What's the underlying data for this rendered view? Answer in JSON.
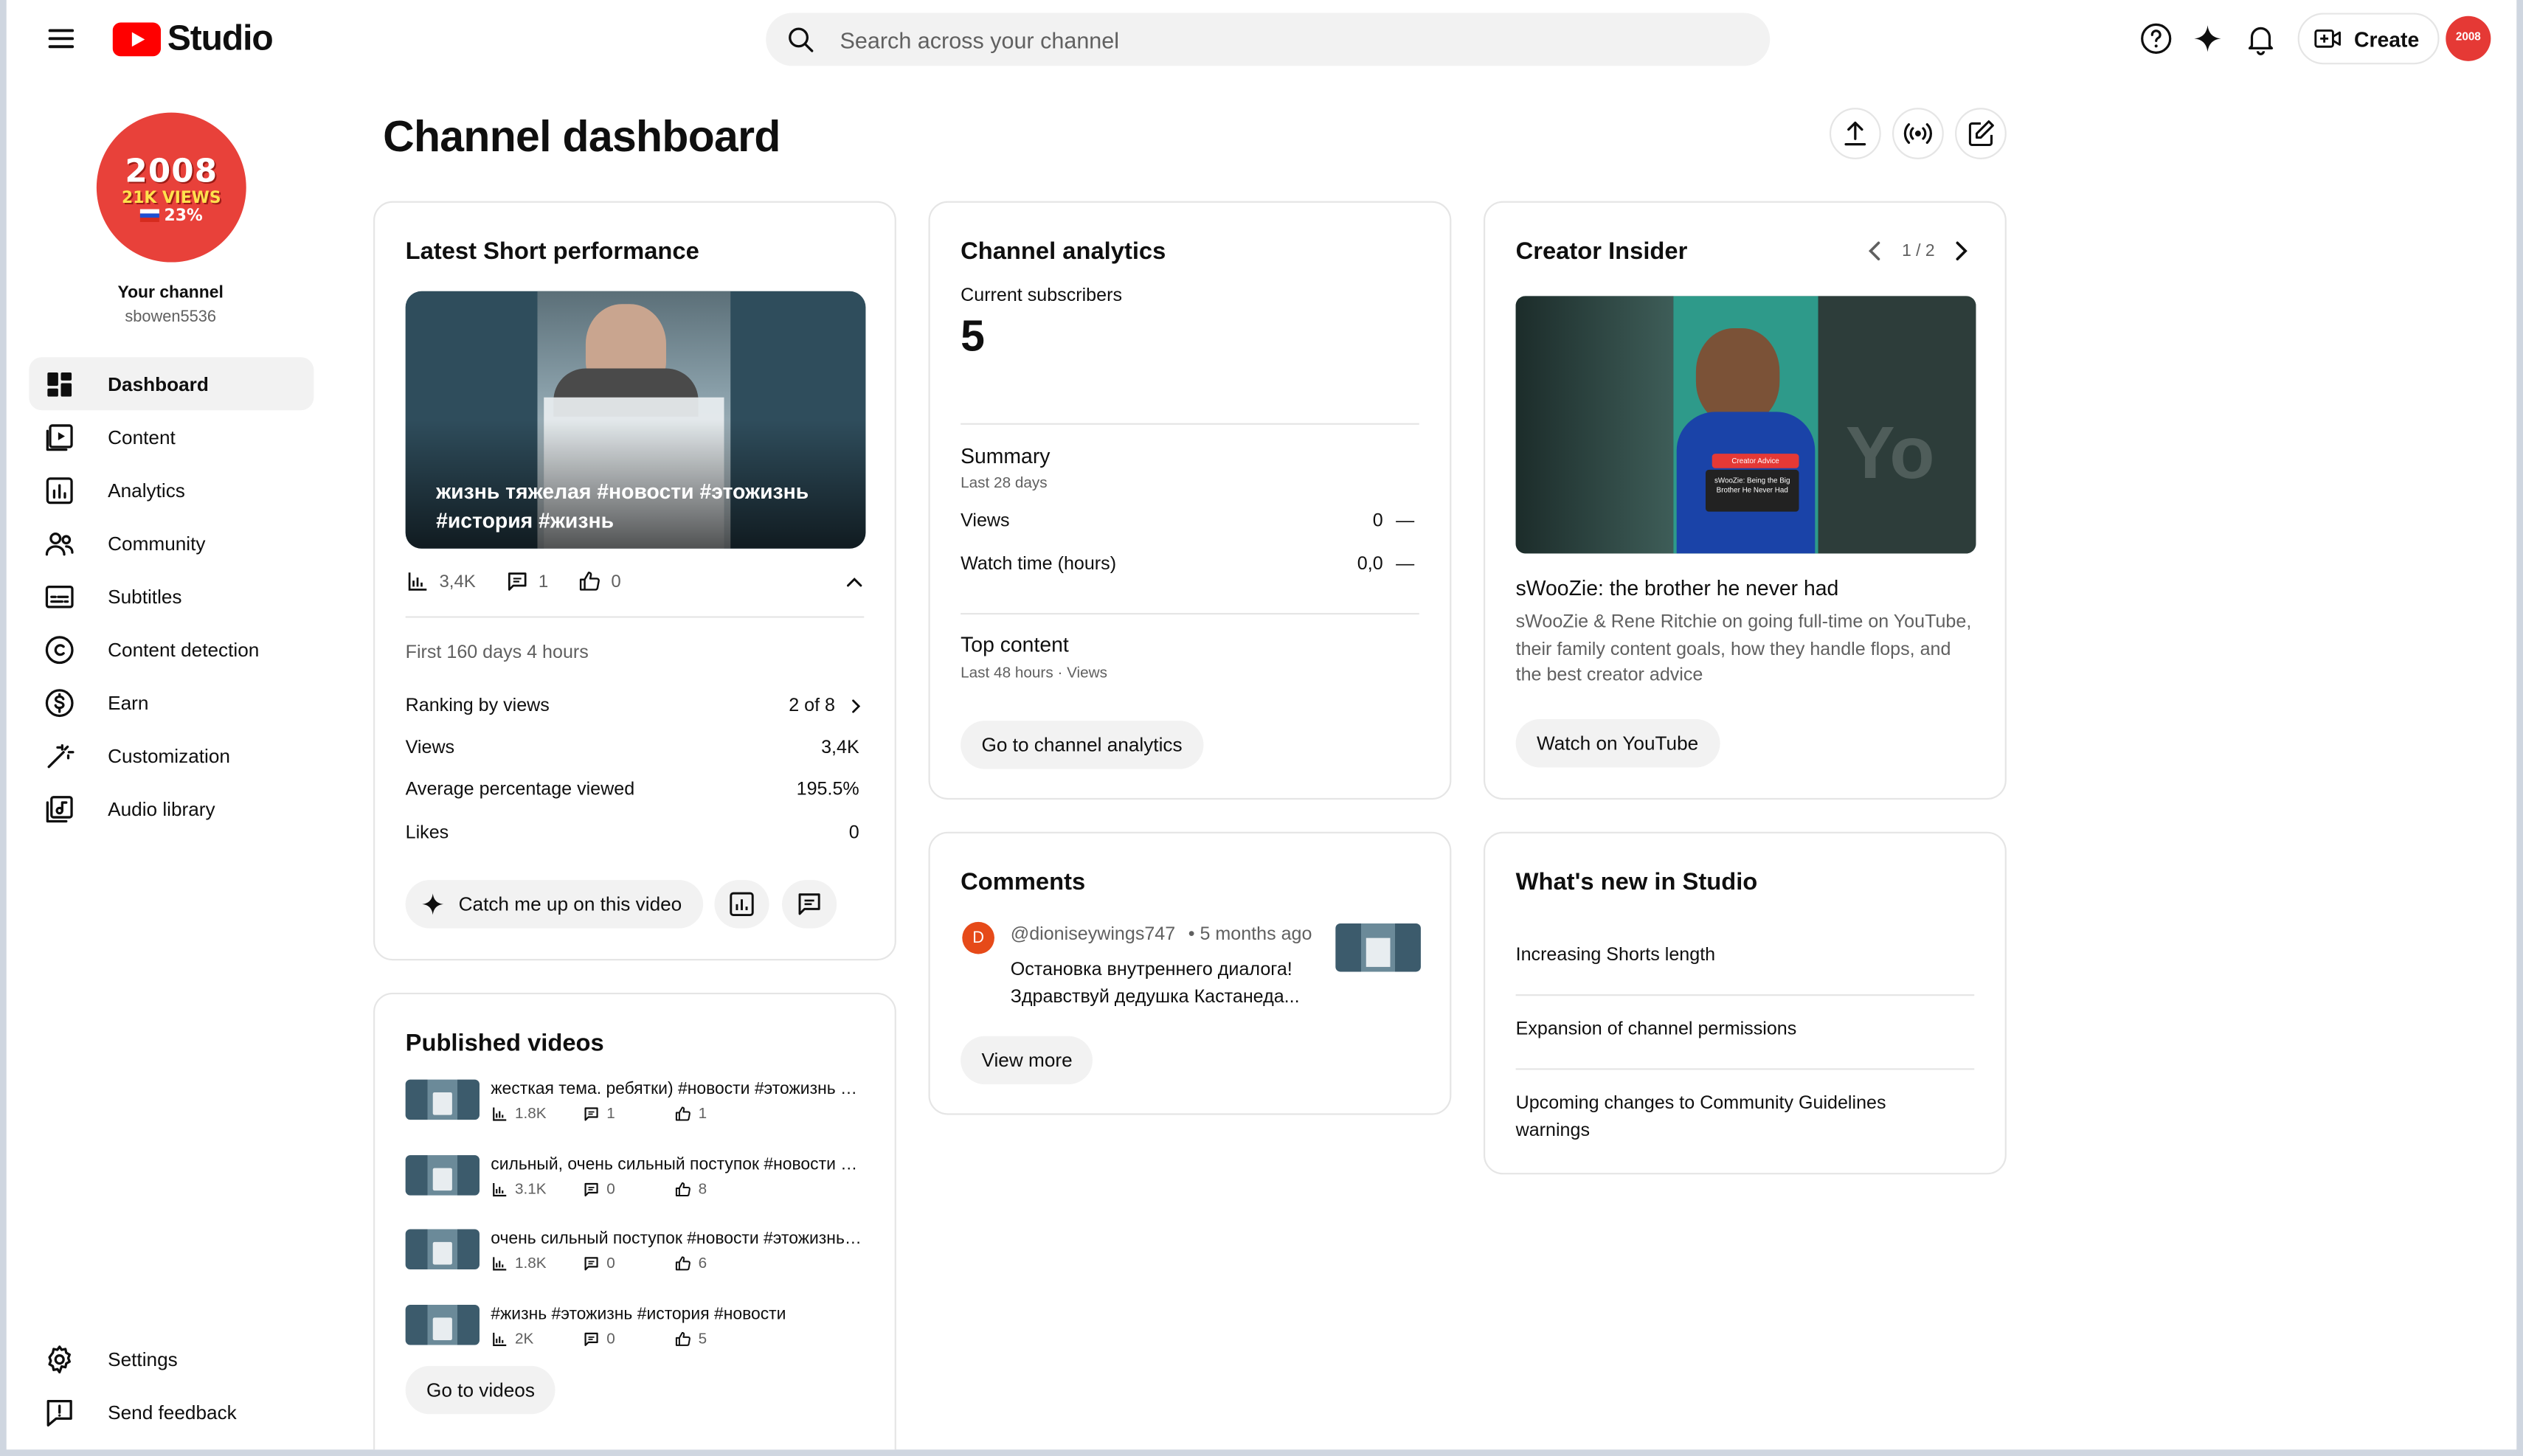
{
  "app": {
    "logo_text": "Studio",
    "search_placeholder": "Search across your channel",
    "create_label": "Create"
  },
  "channel": {
    "avatar_year": "2008",
    "avatar_views": "21K VIEWS",
    "avatar_pct": "23%",
    "your_channel_label": "Your channel",
    "handle": "sbowen5536"
  },
  "sidebar": {
    "items": [
      {
        "label": "Dashboard",
        "icon": "dashboard-icon"
      },
      {
        "label": "Content",
        "icon": "content-icon"
      },
      {
        "label": "Analytics",
        "icon": "analytics-icon"
      },
      {
        "label": "Community",
        "icon": "community-icon"
      },
      {
        "label": "Subtitles",
        "icon": "subtitles-icon"
      },
      {
        "label": "Content detection",
        "icon": "copyright-icon"
      },
      {
        "label": "Earn",
        "icon": "dollar-icon"
      },
      {
        "label": "Customization",
        "icon": "magic-wand-icon"
      },
      {
        "label": "Audio library",
        "icon": "audio-library-icon"
      }
    ],
    "bottom": [
      {
        "label": "Settings",
        "icon": "gear-icon"
      },
      {
        "label": "Send feedback",
        "icon": "feedback-icon"
      }
    ]
  },
  "page": {
    "title": "Channel dashboard"
  },
  "latest_short": {
    "title": "Latest Short performance",
    "thumb_caption": "жизнь тяжелая #новости #этожизнь #история #жизнь",
    "views": "3,4K",
    "comments": "1",
    "likes": "0",
    "period": "First 160 days 4 hours",
    "rows": [
      {
        "label": "Ranking by views",
        "value": "2 of 8"
      },
      {
        "label": "Views",
        "value": "3,4K"
      },
      {
        "label": "Average percentage viewed",
        "value": "195.5%"
      },
      {
        "label": "Likes",
        "value": "0"
      }
    ],
    "catch_up_label": "Catch me up on this video"
  },
  "analytics": {
    "title": "Channel analytics",
    "subs_label": "Current subscribers",
    "subs_value": "5",
    "summary_title": "Summary",
    "summary_period": "Last 28 days",
    "rows": [
      {
        "label": "Views",
        "value": "0",
        "trend": "—"
      },
      {
        "label": "Watch time (hours)",
        "value": "0,0",
        "trend": "—"
      }
    ],
    "top_content_title": "Top content",
    "top_content_period": "Last 48 hours · Views",
    "button_label": "Go to channel analytics"
  },
  "insider": {
    "title": "Creator Insider",
    "pager": "1 / 2",
    "video_title": "sWooZie: the brother he never had",
    "description": "sWooZie & Rene Ritchie on going full-time on YouTube, their family content goals, how they handle flops, and the best creator advice",
    "button_label": "Watch on YouTube",
    "thumb_badge": "Creator Advice",
    "thumb_card_text": "sWooZie: Being the Big Brother He Never Had"
  },
  "comments": {
    "title": "Comments",
    "author": "@dioniseywings747",
    "author_initial": "D",
    "time": "• 5 months ago",
    "text_line1": "Остановка внутреннего диалога!",
    "text_line2": "Здравствуй дедушка Кастанеда...",
    "button_label": "View more"
  },
  "whats_new": {
    "title": "What's new in Studio",
    "items": [
      "Increasing Shorts length",
      "Expansion of channel permissions",
      "Upcoming changes to Community Guidelines warnings"
    ]
  },
  "published": {
    "title": "Published videos",
    "videos": [
      {
        "title": "жесткая тема. ребятки) #новости #этожизнь #история",
        "views": "1.8K",
        "comments": "1",
        "likes": "1"
      },
      {
        "title": "сильный, очень сильный поступок #новости #этожизнь",
        "views": "3.1K",
        "comments": "0",
        "likes": "8"
      },
      {
        "title": "очень сильный поступок #новости #этожизнь #история",
        "views": "1.8K",
        "comments": "0",
        "likes": "6"
      },
      {
        "title": "#жизнь #этожизнь #история #новости",
        "views": "2K",
        "comments": "0",
        "likes": "5"
      }
    ],
    "button_label": "Go to videos"
  },
  "colors": {
    "brand_red": "#ff0000",
    "avatar_red": "#e8413a",
    "surface": "#f2f2f2",
    "border": "#e5e5e5",
    "muted_text": "#606060"
  }
}
